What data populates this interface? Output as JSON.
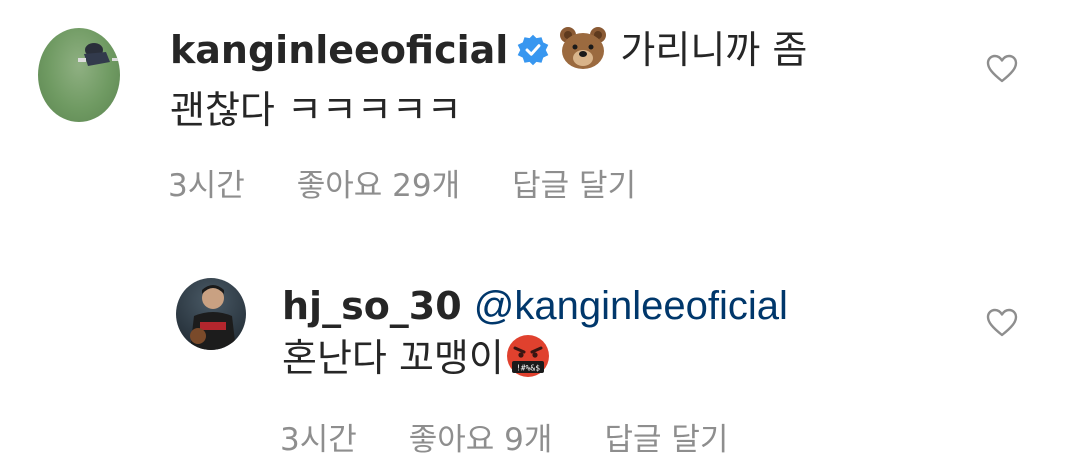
{
  "comments": [
    {
      "username": "kanginleeoficial",
      "verified": true,
      "emoji": "bear-face",
      "text_line1": "가리니까 좀",
      "text_line2": "괜찮다 ㅋㅋㅋㅋㅋ",
      "time": "3시간",
      "likes": "좋아요 29개",
      "reply": "답글 달기"
    },
    {
      "username": "hj_so_30",
      "mention": "@kanginleeoficial",
      "text": "혼난다 꼬맹이",
      "emoji": "face-with-symbols-on-mouth",
      "time": "3시간",
      "likes": "좋아요 9개",
      "reply": "답글 달기"
    }
  ],
  "icons": {
    "heart": "heart-outline-icon",
    "verified_color": "#3897f0"
  }
}
